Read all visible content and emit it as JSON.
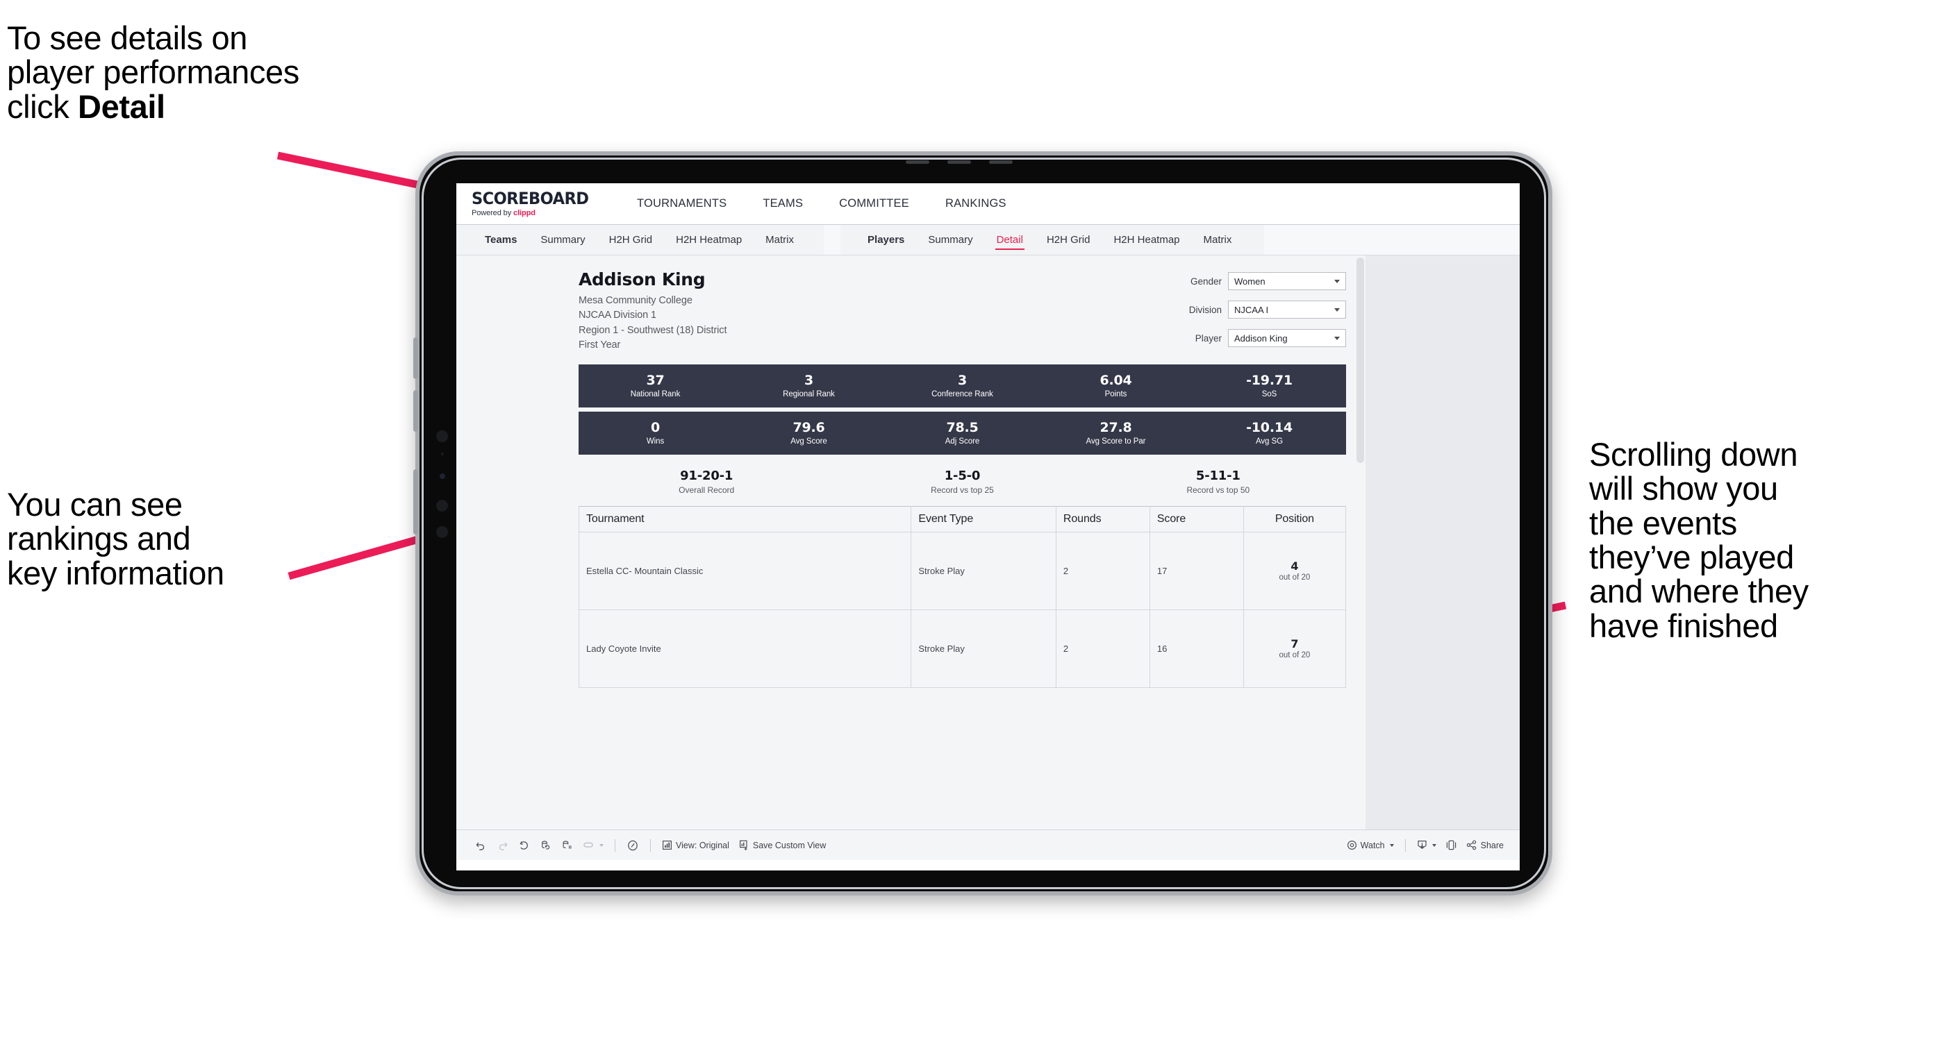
{
  "annotations": {
    "top_left_plain_1": "To see details on",
    "top_left_plain_2": "player performances",
    "top_left_plain_3": "click ",
    "top_left_bold": "Detail",
    "bottom_left": "You can see\nrankings and\nkey information",
    "right": "Scrolling down\nwill show you\nthe events\nthey’ve played\nand where they\nhave finished",
    "arrow_color": "#ec1c58"
  },
  "app": {
    "logo": {
      "wordmark": "SCOREBOARD",
      "powered_by_prefix": "Powered by ",
      "powered_by_brand": "clippd"
    },
    "main_nav": [
      {
        "label": "TOURNAMENTS"
      },
      {
        "label": "TEAMS"
      },
      {
        "label": "COMMITTEE"
      },
      {
        "label": "RANKINGS"
      }
    ],
    "sub_nav": {
      "group_teams": [
        {
          "label": "Teams",
          "bold": true,
          "active": false
        },
        {
          "label": "Summary",
          "bold": false,
          "active": false
        },
        {
          "label": "H2H Grid",
          "bold": false,
          "active": false
        },
        {
          "label": "H2H Heatmap",
          "bold": false,
          "active": false
        },
        {
          "label": "Matrix",
          "bold": false,
          "active": false
        }
      ],
      "group_players": [
        {
          "label": "Players",
          "bold": true,
          "active": false
        },
        {
          "label": "Summary",
          "bold": false,
          "active": false
        },
        {
          "label": "Detail",
          "bold": false,
          "active": true
        },
        {
          "label": "H2H Grid",
          "bold": false,
          "active": false
        },
        {
          "label": "H2H Heatmap",
          "bold": false,
          "active": false
        },
        {
          "label": "Matrix",
          "bold": false,
          "active": false
        }
      ]
    }
  },
  "player": {
    "name": "Addison King",
    "school": "Mesa Community College",
    "division": "NJCAA Division 1",
    "region": "Region 1 - Southwest (18) District",
    "year": "First Year"
  },
  "filters": [
    {
      "label": "Gender",
      "value": "Women"
    },
    {
      "label": "Division",
      "value": "NJCAA I"
    },
    {
      "label": "Player",
      "value": "Addison King"
    }
  ],
  "stats_row_1": [
    {
      "value": "37",
      "label": "National Rank"
    },
    {
      "value": "3",
      "label": "Regional Rank"
    },
    {
      "value": "3",
      "label": "Conference Rank"
    },
    {
      "value": "6.04",
      "label": "Points"
    },
    {
      "value": "-19.71",
      "label": "SoS"
    }
  ],
  "stats_row_2": [
    {
      "value": "0",
      "label": "Wins"
    },
    {
      "value": "79.6",
      "label": "Avg Score"
    },
    {
      "value": "78.5",
      "label": "Adj Score"
    },
    {
      "value": "27.8",
      "label": "Avg Score to Par"
    },
    {
      "value": "-10.14",
      "label": "Avg SG"
    }
  ],
  "records": [
    {
      "value": "91-20-1",
      "label": "Overall Record"
    },
    {
      "value": "1-5-0",
      "label": "Record vs top 25"
    },
    {
      "value": "5-11-1",
      "label": "Record vs top 50"
    }
  ],
  "tournaments_table": {
    "columns": [
      "Tournament",
      "Event Type",
      "Rounds",
      "Score",
      "Position"
    ],
    "rows": [
      {
        "tournament": "Estella CC- Mountain Classic",
        "event_type": "Stroke Play",
        "rounds": "2",
        "score": "17",
        "position_num": "4",
        "position_out": "out of 20"
      },
      {
        "tournament": "Lady Coyote Invite",
        "event_type": "Stroke Play",
        "rounds": "2",
        "score": "16",
        "position_num": "7",
        "position_out": "out of 20"
      }
    ]
  },
  "toolbar": {
    "undo": "undo-icon",
    "redo": "redo-icon",
    "revert": "revert-icon",
    "refresh": "refresh-icon",
    "pause": "pause-icon",
    "loop": "loop-icon",
    "presentation": "presentation-icon",
    "view_label": "View: Original",
    "save_custom_view_label": "Save Custom View",
    "watch_label": "Watch",
    "download_label": "download-icon",
    "device_label": "device-layout-icon",
    "share_label": "Share"
  },
  "colors": {
    "accent_pink": "#e8214f",
    "stat_bar_navy": "#353849",
    "brand_red": "#ec1c58",
    "workbook_bg": "#e9eaed",
    "sheet_bg": "#f4f5f7"
  }
}
